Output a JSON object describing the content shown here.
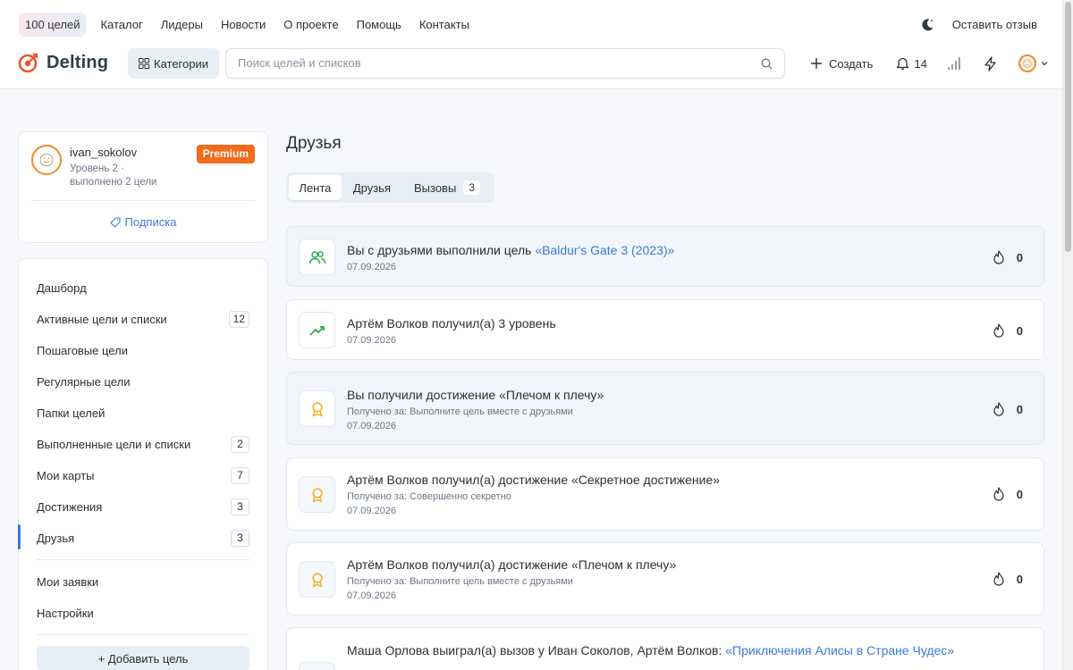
{
  "header": {
    "top_links": {
      "goals_pill": "100 целей",
      "catalog": "Каталог",
      "leaders": "Лидеры",
      "news": "Новости",
      "about": "О проекте",
      "help": "Помощь",
      "contacts": "Контакты"
    },
    "feedback": "Оставить отзыв",
    "logo_text": "Delting",
    "categories_label": "Категории",
    "search_placeholder": "Поиск целей и списков",
    "create_label": "Создать",
    "notifications_count": "14"
  },
  "profile": {
    "username": "ivan_sokolov",
    "level": "Уровень 2 ·",
    "done": "выполнено 2 цели",
    "badge": "Premium",
    "subscription": "Подписка"
  },
  "menu": {
    "items": [
      {
        "label": "Дашборд",
        "count": ""
      },
      {
        "label": "Активные цели и списки",
        "count": "12"
      },
      {
        "label": "Пошаговые цели",
        "count": ""
      },
      {
        "label": "Регулярные цели",
        "count": ""
      },
      {
        "label": "Папки целей",
        "count": ""
      },
      {
        "label": "Выполненные цели и списки",
        "count": "2"
      },
      {
        "label": "Мои карты",
        "count": "7"
      },
      {
        "label": "Достижения",
        "count": "3"
      },
      {
        "label": "Друзья",
        "count": "3"
      }
    ],
    "secondary": [
      {
        "label": "Мои заявки"
      },
      {
        "label": "Настройки"
      }
    ],
    "add_goal": "+ Добавить цель"
  },
  "main": {
    "title": "Друзья",
    "tabs": [
      {
        "label": "Лента"
      },
      {
        "label": "Друзья"
      },
      {
        "label": "Вызовы",
        "count": "3"
      }
    ]
  },
  "feed": [
    {
      "actor": "",
      "text": "Вы с друзьями выполнили цель ",
      "link": "«Baldur's Gate 3 (2023)»",
      "sub": "",
      "date": "07.09.2026",
      "likes": "0",
      "icon": "friends-icon"
    },
    {
      "actor": "Артём Волков",
      "text": " получил(а) 3 уровень",
      "link": "",
      "sub": "",
      "date": "07.09.2026",
      "likes": "0",
      "icon": "trend-up-icon"
    },
    {
      "actor": "",
      "text": "Вы получили достижение «Плечом к плечу»",
      "link": "",
      "sub": "Получено за: Выполните цель вместе с друзьями",
      "date": "07.09.2026",
      "likes": "0",
      "icon": "award-icon"
    },
    {
      "actor": "Артём Волков",
      "text": " получил(а) достижение «Секретное достижение»",
      "link": "",
      "sub": "Получено за: Совершенно секретно",
      "date": "07.09.2026",
      "likes": "0",
      "icon": "award-icon"
    },
    {
      "actor": "Артём Волков",
      "text": " получил(а) достижение «Плечом к плечу»",
      "link": "",
      "sub": "Получено за: Выполните цель вместе с друзьями",
      "date": "07.09.2026",
      "likes": "0",
      "icon": "award-icon"
    },
    {
      "actor": "Маша Орлова",
      "text": " выиграл(а) вызов у Иван Соколов, Артём Волков: ",
      "link": "«Приключения Алисы в Стране Чудес»",
      "sub": "",
      "date": "",
      "likes": "",
      "icon": "trophy-icon"
    }
  ],
  "colors": {
    "accent": "#3a7ad5",
    "premium": "#f26a1b",
    "logo": "#e8552a",
    "green": "#2fa84f",
    "gold": "#f0b429"
  }
}
